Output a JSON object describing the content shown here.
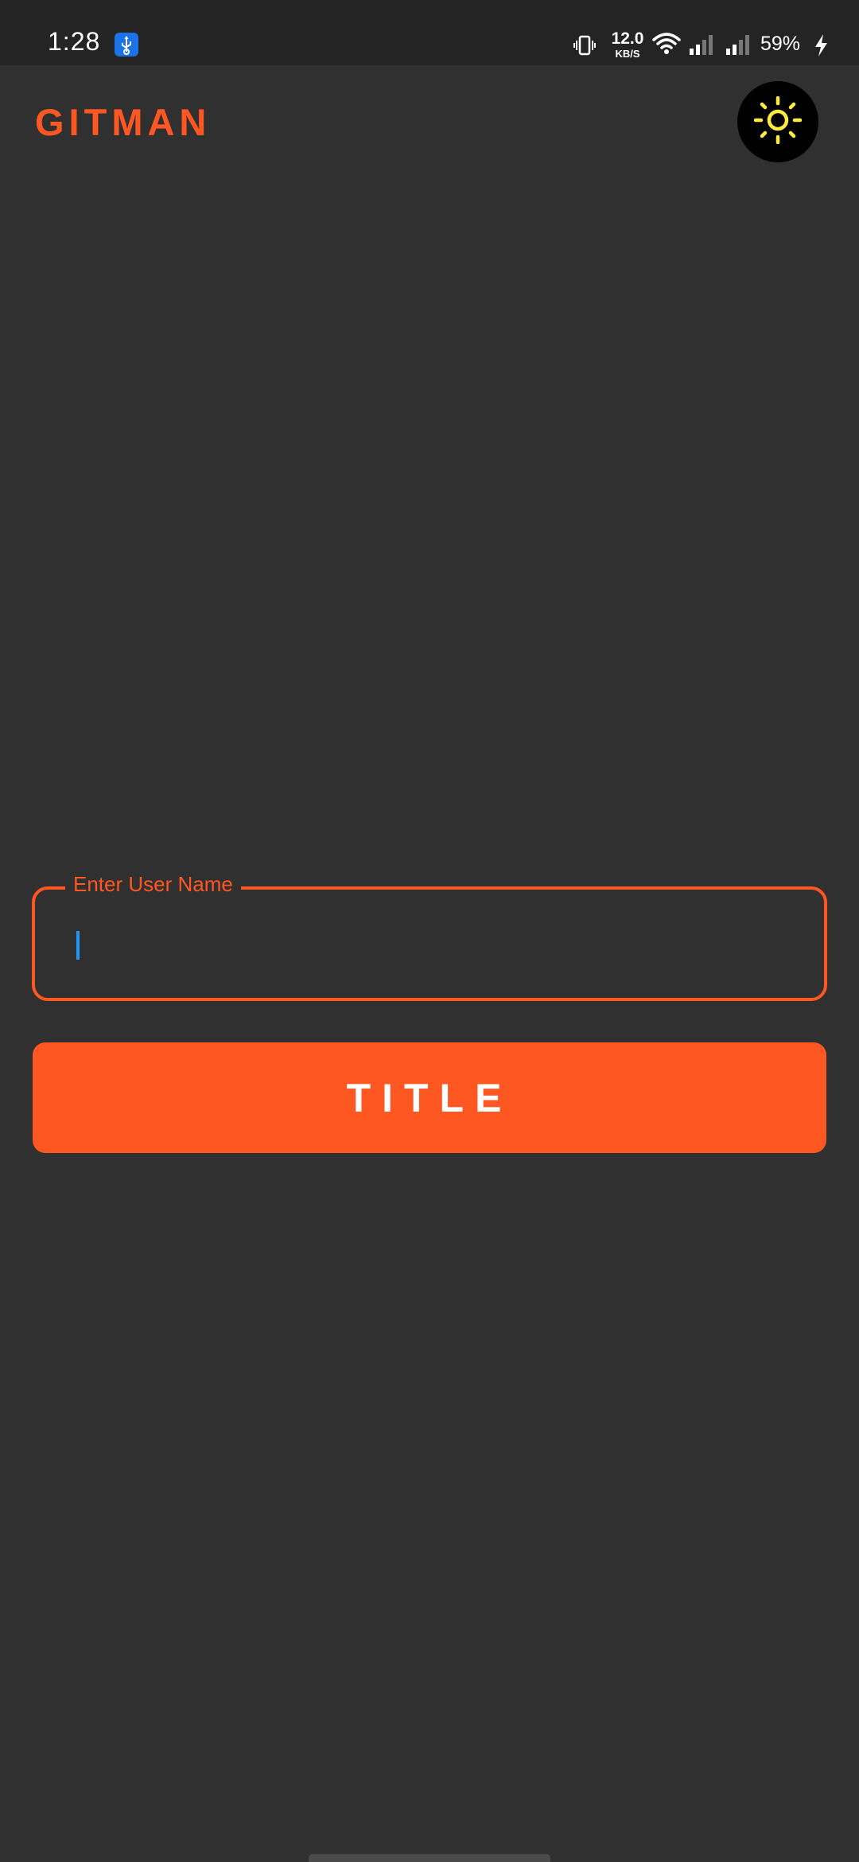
{
  "status_bar": {
    "time": "1:28",
    "usb_icon": "usb-icon",
    "network_speed_value": "12.0",
    "network_speed_unit": "KB/S",
    "battery_percent": "59%"
  },
  "header": {
    "app_title": "GITMAN",
    "theme_toggle_icon": "sun-icon"
  },
  "form": {
    "username_label": "Enter User Name",
    "username_value": "",
    "submit_label": "TITLE"
  },
  "colors": {
    "accent": "#ff5722",
    "background": "#303030",
    "status_bar": "#242424",
    "sun": "#ffeb3b",
    "caret": "#2196f3"
  }
}
